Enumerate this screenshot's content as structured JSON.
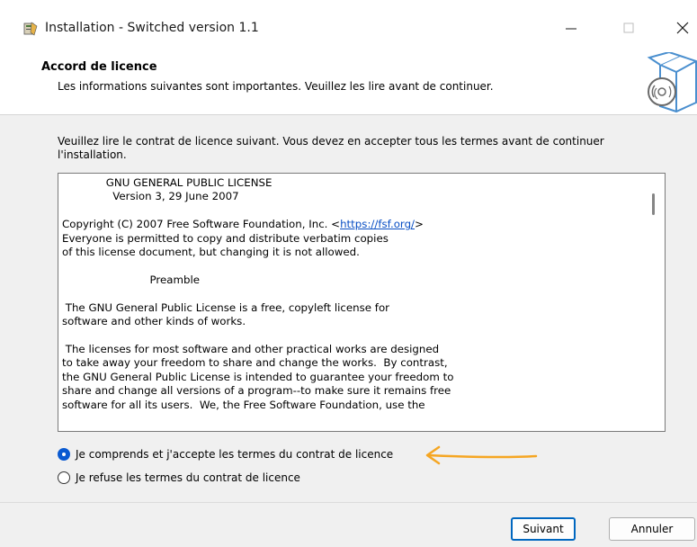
{
  "window": {
    "title": "Installation - Switched version 1.1"
  },
  "header": {
    "title": "Accord de licence",
    "subtitle": "Les informations suivantes sont importantes. Veuillez les lire avant de continuer."
  },
  "intro_text": "Veuillez lire le contrat de licence suivant. Vous devez en accepter tous les termes avant de continuer l'installation.",
  "license": {
    "line1": "             GNU GENERAL PUBLIC LICENSE",
    "line2": "               Version 3, 29 June 2007",
    "line3": "",
    "line4_pre": "Copyright (C) 2007 Free Software Foundation, Inc. <",
    "line4_link": "https://fsf.org/",
    "line4_post": ">",
    "line5": "Everyone is permitted to copy and distribute verbatim copies",
    "line6": "of this license document, but changing it is not allowed.",
    "line7": "",
    "line8": "                          Preamble",
    "line9": "",
    "line10": " The GNU General Public License is a free, copyleft license for",
    "line11": "software and other kinds of works.",
    "line12": "",
    "line13": " The licenses for most software and other practical works are designed",
    "line14": "to take away your freedom to share and change the works.  By contrast,",
    "line15": "the GNU General Public License is intended to guarantee your freedom to",
    "line16": "share and change all versions of a program--to make sure it remains free",
    "line17": "software for all its users.  We, the Free Software Foundation, use the"
  },
  "options": {
    "accept_label": "Je comprends et j'accepte les termes du contrat de licence",
    "refuse_label": "Je refuse les termes du contrat de licence",
    "selected": "accept"
  },
  "buttons": {
    "next_label": "Suivant",
    "cancel_label": "Annuler"
  },
  "colors": {
    "accent": "#0a5ad1",
    "arrow": "#f5a623",
    "link": "#0a4fc4"
  }
}
